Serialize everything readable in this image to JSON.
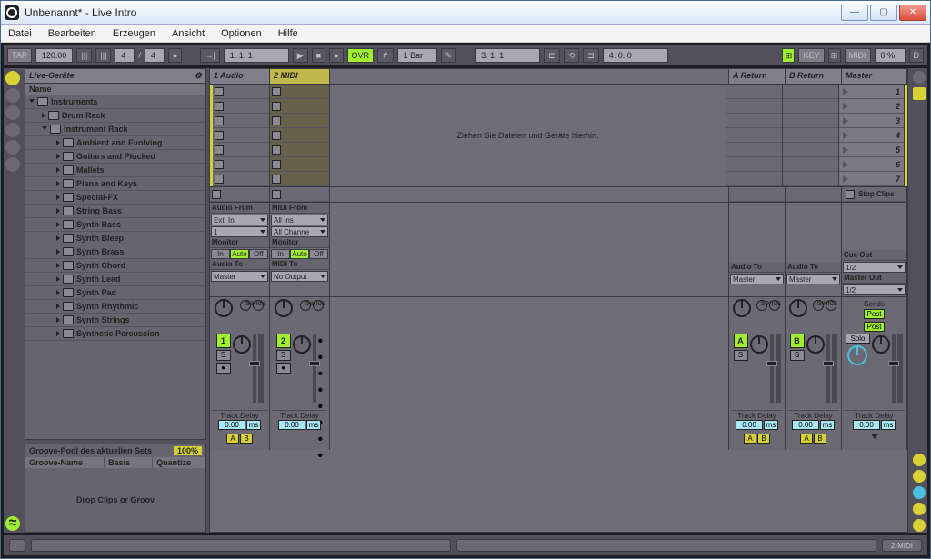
{
  "window": {
    "title": "Unbenannt* - Live Intro"
  },
  "menu": [
    "Datei",
    "Bearbeiten",
    "Erzeugen",
    "Ansicht",
    "Optionen",
    "Hilfe"
  ],
  "transport": {
    "tap": "TAP",
    "tempo": "120.00",
    "sig_num": "4",
    "sig_den": "4",
    "position": "1.  1.  1",
    "ovr": "OVR",
    "quantize": "1 Bar",
    "arr_pos": "3.  1.  1",
    "loop_len": "4.  0.  0",
    "key": "KEY",
    "midi": "MIDI",
    "midi_pct": "0 %",
    "d": "D"
  },
  "browser": {
    "head": "Live-Geräte",
    "name_col": "Name",
    "tree": [
      {
        "lvl": 0,
        "open": true,
        "label": "Instruments"
      },
      {
        "lvl": 1,
        "open": false,
        "label": "Drum Rack"
      },
      {
        "lvl": 1,
        "open": true,
        "label": "Instrument Rack"
      },
      {
        "lvl": 2,
        "open": false,
        "label": "Ambient and Evolving"
      },
      {
        "lvl": 2,
        "open": false,
        "label": "Guitars and Plucked"
      },
      {
        "lvl": 2,
        "open": false,
        "label": "Mallets"
      },
      {
        "lvl": 2,
        "open": false,
        "label": "Piano and Keys"
      },
      {
        "lvl": 2,
        "open": false,
        "label": "Special-FX"
      },
      {
        "lvl": 2,
        "open": false,
        "label": "String Bass"
      },
      {
        "lvl": 2,
        "open": false,
        "label": "Synth Bass"
      },
      {
        "lvl": 2,
        "open": false,
        "label": "Synth Bleep"
      },
      {
        "lvl": 2,
        "open": false,
        "label": "Synth Brass"
      },
      {
        "lvl": 2,
        "open": false,
        "label": "Synth Chord"
      },
      {
        "lvl": 2,
        "open": false,
        "label": "Synth Lead"
      },
      {
        "lvl": 2,
        "open": false,
        "label": "Synth Pad"
      },
      {
        "lvl": 2,
        "open": false,
        "label": "Synth Rhythmic"
      },
      {
        "lvl": 2,
        "open": false,
        "label": "Synth Strings"
      },
      {
        "lvl": 2,
        "open": false,
        "label": "Synthetic Percussion"
      }
    ]
  },
  "groove": {
    "title": "Groove-Pool des aktuellen Sets",
    "pct": "100%",
    "cols": [
      "Groove-Name",
      "Basis",
      "Quantize"
    ],
    "drop": "Drop Clips or Groov"
  },
  "tracks": {
    "t1": "1 Audio",
    "t2": "2 MIDI",
    "ra": "A Return",
    "rb": "B Return",
    "master": "Master",
    "drop_hint": "Ziehen Sie Dateien und Geräte hierhin.",
    "scenes": [
      "1",
      "2",
      "3",
      "4",
      "5",
      "6",
      "7"
    ],
    "stop_clips": "Stop Clips"
  },
  "io": {
    "audio_from": "Audio From",
    "midi_from": "MIDI From",
    "ext_in": "Ext. In",
    "all_ins": "All Ins",
    "ch1": "1",
    "all_ch": "All Channe",
    "monitor": "Monitor",
    "in": "In",
    "auto": "Auto",
    "off": "Off",
    "audio_to": "Audio To",
    "midi_to": "MIDI To",
    "master": "Master",
    "no_output": "No Output",
    "cue_out": "Cue Out",
    "master_out": "Master Out",
    "out12": "1/2"
  },
  "mixer": {
    "sends": "Sends",
    "post": "Post",
    "act1": "1",
    "act2": "2",
    "actA": "A",
    "actB": "B",
    "s": "S",
    "solo": "Solo",
    "track_delay": "Track Delay",
    "delay_val": "0.00",
    "ms": "ms",
    "a": "A",
    "b": "B"
  },
  "status": {
    "view": "2-MIDI"
  }
}
